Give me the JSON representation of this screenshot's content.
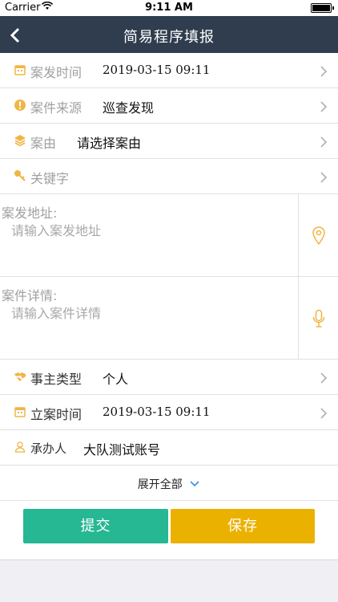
{
  "status_bar": {
    "carrier": "Carrier",
    "time": "9:11 AM"
  },
  "navbar": {
    "title": "简易程序填报"
  },
  "rows": {
    "case_time": {
      "label": "案发时间",
      "value": "2019-03-15 09:11"
    },
    "case_source": {
      "label": "案件来源",
      "value": "巡查发现"
    },
    "case_reason": {
      "label": "案由",
      "value": "请选择案由"
    },
    "keyword": {
      "label": "关键字",
      "value": ""
    },
    "party_type": {
      "label": "事主类型",
      "value": "个人"
    },
    "filing_time": {
      "label": "立案时间",
      "value": "2019-03-15 09:11"
    },
    "handler": {
      "label": "承办人",
      "value": "大队测试账号"
    }
  },
  "address": {
    "label": "案发地址:",
    "placeholder": "请输入案发地址"
  },
  "details": {
    "label": "案件详情:",
    "placeholder": "请输入案件详情"
  },
  "expand": {
    "label": "展开全部"
  },
  "buttons": {
    "submit": "提交",
    "save": "保存"
  },
  "colors": {
    "nav": "#2f3d4e",
    "accent": "#f0b545",
    "submit": "#26b793",
    "save": "#ebb100"
  }
}
